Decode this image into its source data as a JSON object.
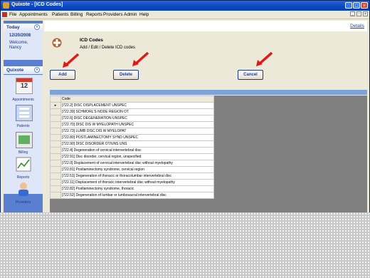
{
  "window": {
    "title": "Quixote - [ICD Codes]"
  },
  "menu": [
    "File",
    "Appointments",
    "Patients",
    "Billing",
    "Reports",
    "Providers",
    "Admin",
    "Help"
  ],
  "today": {
    "header": "Today",
    "date": "12/20/2008",
    "welcome": "Welcome,",
    "user": "Nancy"
  },
  "nav": {
    "header": "Quixote",
    "items": [
      "Appointments",
      "Patients",
      "Billing",
      "Reports",
      "Providers"
    ],
    "calendar_day": "12"
  },
  "content": {
    "details_link": "Details",
    "title": "ICD Codes",
    "subtitle": "Add / Edit / Delete ICD codes",
    "buttons": {
      "add": "Add",
      "delete": "Delete",
      "cancel": "Cancel"
    }
  },
  "grid": {
    "column": "Code",
    "rows": [
      "[722.2] DISC DISPLACEMENT UNSPEC",
      "[722.39] SCHMORL'S NODE REGION OT",
      "[722.6] DISC DEGENERATION UNSPEC",
      "[722.70] DISC DIS W MYELOPATH UNSPEC",
      "[722.73] LUMB DISC DIS W MYELOPAT",
      "[722.80] POSTLAMINECTOMY SYND UNSPEC",
      "[722.90] DISC DISORDER OT/UNS UNS",
      "[722.4] Degeneration of cervical intervertebral disc",
      "[722.91] Disc disorder, cervical region, unspecified",
      "[722.0] Displacement of cervical intervertebral disc without myelopathy",
      "[722.81] Postlaminectomy syndrome, cervical region",
      "[722.51] Degeneration of thoracic or thoracolumbar intervertebral disc",
      "[722.11] Displacement of thoracic intervertebral disc without myelopathy",
      "[722.82] Postlaminectomy syndrome, thoracic",
      "[722.52] Degeneration of lumbar or lumbosacral intervertebral disc"
    ]
  },
  "colors": {
    "titlebar": "#0a46c0",
    "nav_pane": "#5a7fd0",
    "arrow": "#e01818",
    "grid_bg": "#808080"
  }
}
